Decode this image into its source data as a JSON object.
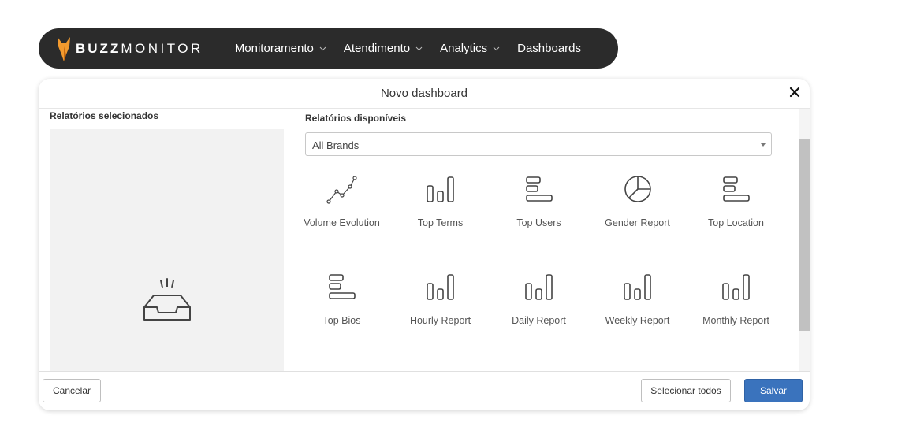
{
  "nav": {
    "brand_bold": "BUZZ",
    "brand_light": "MONITOR",
    "items": [
      {
        "label": "Monitoramento",
        "has_dropdown": true
      },
      {
        "label": "Atendimento",
        "has_dropdown": true
      },
      {
        "label": "Analytics",
        "has_dropdown": true
      },
      {
        "label": "Dashboards",
        "has_dropdown": false
      }
    ]
  },
  "modal": {
    "title": "Novo dashboard",
    "selected_title": "Relatórios selecionados",
    "available_title": "Relatórios disponíveis",
    "filter": {
      "selected": "All Brands"
    },
    "reports": [
      {
        "label": "Volume Evolution",
        "icon": "line-chart-icon"
      },
      {
        "label": "Top Terms",
        "icon": "bar-chart-icon"
      },
      {
        "label": "Top Users",
        "icon": "horizontal-bars-icon"
      },
      {
        "label": "Gender Report",
        "icon": "pie-chart-icon"
      },
      {
        "label": "Top Location",
        "icon": "horizontal-bars-icon"
      },
      {
        "label": "Top Bios",
        "icon": "horizontal-bars-icon"
      },
      {
        "label": "Hourly Report",
        "icon": "bar-chart-icon"
      },
      {
        "label": "Daily Report",
        "icon": "bar-chart-icon"
      },
      {
        "label": "Weekly Report",
        "icon": "bar-chart-icon"
      },
      {
        "label": "Monthly Report",
        "icon": "bar-chart-icon"
      }
    ],
    "footer": {
      "cancel_label": "Cancelar",
      "select_all_label": "Selecionar todos",
      "save_label": "Salvar"
    }
  },
  "colors": {
    "navbar_bg": "#2b2b2b",
    "logo_orange": "#f29a2e",
    "primary_button": "#3a73bd",
    "empty_panel": "#f2f2f2"
  }
}
